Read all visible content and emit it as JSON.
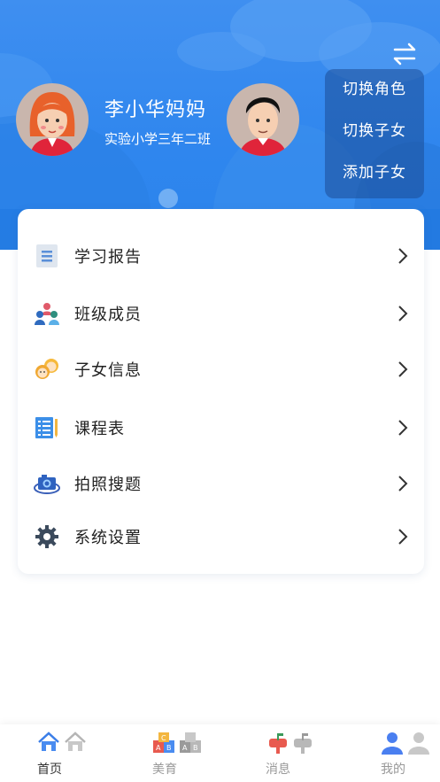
{
  "profile": {
    "name": "李小华妈妈",
    "class": "实验小学三年二班"
  },
  "switch_menu": {
    "items": [
      "切换角色",
      "切换子女",
      "添加子女"
    ]
  },
  "menu": {
    "items": [
      {
        "label": "学习报告",
        "icon": "report-icon"
      },
      {
        "label": "班级成员",
        "icon": "class-members-icon"
      },
      {
        "label": "子女信息",
        "icon": "children-info-icon"
      },
      {
        "label": "课程表",
        "icon": "schedule-icon"
      },
      {
        "label": "拍照搜题",
        "icon": "camera-icon"
      },
      {
        "label": "系统设置",
        "icon": "gear-icon"
      }
    ]
  },
  "tabbar": {
    "tabs": [
      {
        "label": "首页",
        "active": true
      },
      {
        "label": "美育",
        "active": false
      },
      {
        "label": "消息",
        "active": false
      },
      {
        "label": "我的",
        "active": false
      }
    ]
  },
  "colors": {
    "header_blue": "#3f8ff0",
    "accent": "#3b82f6"
  }
}
